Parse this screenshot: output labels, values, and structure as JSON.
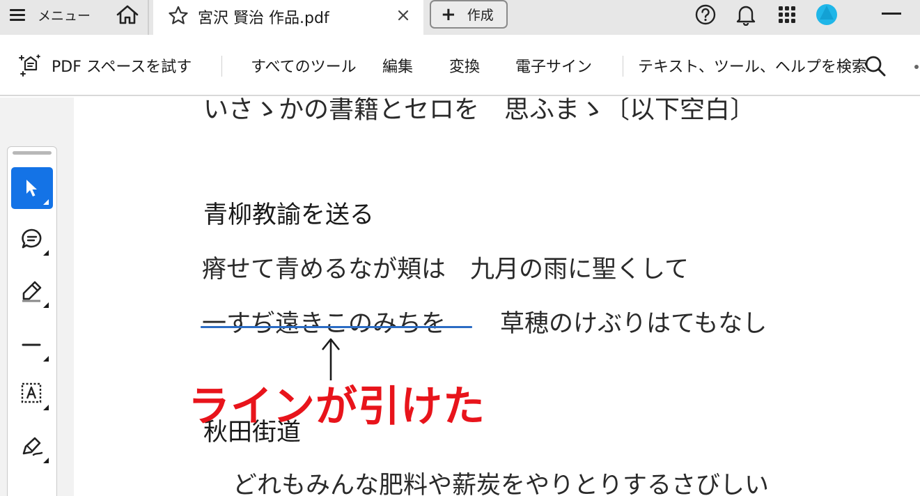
{
  "titlebar": {
    "menu_label": "メニュー",
    "tab_title": "宮沢 賢治 作品.pdf",
    "create_label": "作成",
    "avatar_color": "#1fb6e8",
    "icons": [
      "menu-icon",
      "home-icon",
      "star-icon",
      "close-icon",
      "plus-icon",
      "help-icon",
      "bell-icon",
      "apps-icon",
      "avatar-icon",
      "minimize-icon"
    ]
  },
  "toolbar": {
    "ai_label": "PDF スペースを試す",
    "all_tools": "すべてのツール",
    "edit": "編集",
    "convert": "変換",
    "esign": "電子サイン",
    "search_placeholder": "テキスト、ツール、ヘルプを検索"
  },
  "rail": {
    "tools": [
      "select-tool",
      "comment-tool",
      "highlight-tool",
      "line-tool",
      "text-box-tool",
      "draw-tool"
    ],
    "active": "select-tool",
    "more": "…"
  },
  "document": {
    "cut_line": "いさゝかの書籍とセロを　思ふまゝ〔以下空白〕",
    "heading1": "青柳教諭を送る",
    "line1": "瘠せて青めるなが頬は　九月の雨に聖くして",
    "line2_underlined": "一すぢ遠きこのみちを",
    "line2_rest": "草穂のけぶりはてもなし",
    "heading2": "秋田街道",
    "line3": "どれもみんな肥料や薪炭をやりとりするさびしい"
  },
  "annotation": {
    "arrow": "↑",
    "text": "ラインが引けた",
    "color": "#e8141b",
    "underline_color": "#2b6cc4"
  }
}
